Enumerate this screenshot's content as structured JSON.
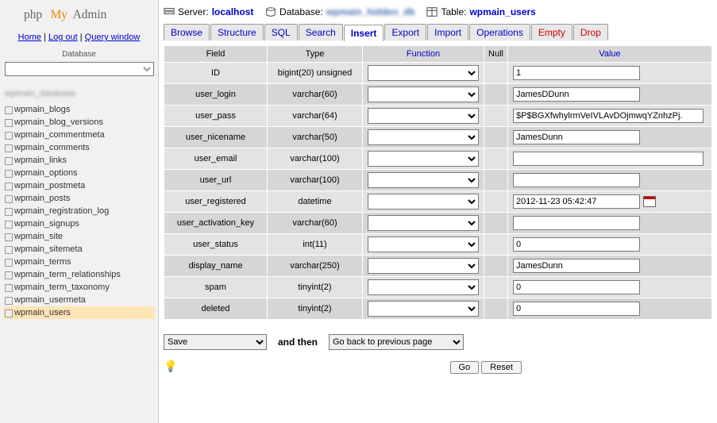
{
  "logo": {
    "php": "php",
    "my": "My",
    "admin": "Admin"
  },
  "toplinks": {
    "home": "Home",
    "logout": "Log out",
    "query": "Query window"
  },
  "db_label": "Database",
  "db_selected": "",
  "db_name": "wpmain_database",
  "tables": [
    "wpmain_blogs",
    "wpmain_blog_versions",
    "wpmain_commentmeta",
    "wpmain_comments",
    "wpmain_links",
    "wpmain_options",
    "wpmain_postmeta",
    "wpmain_posts",
    "wpmain_registration_log",
    "wpmain_signups",
    "wpmain_site",
    "wpmain_sitemeta",
    "wpmain_terms",
    "wpmain_term_relationships",
    "wpmain_term_taxonomy",
    "wpmain_usermeta",
    "wpmain_users"
  ],
  "active_table": "wpmain_users",
  "breadcrumb": {
    "server_lbl": "Server:",
    "server": "localhost",
    "db_lbl": "Database:",
    "db": "(hidden)",
    "table_lbl": "Table:",
    "table": "wpmain_users"
  },
  "tabs": {
    "browse": "Browse",
    "structure": "Structure",
    "sql": "SQL",
    "search": "Search",
    "insert": "Insert",
    "export": "Export",
    "import": "Import",
    "operations": "Operations",
    "empty": "Empty",
    "drop": "Drop"
  },
  "headers": {
    "field": "Field",
    "type": "Type",
    "function": "Function",
    "null": "Null",
    "value": "Value"
  },
  "rows": [
    {
      "field": "ID",
      "type": "bigint(20) unsigned",
      "value": "1"
    },
    {
      "field": "user_login",
      "type": "varchar(60)",
      "value": "JamesDDunn"
    },
    {
      "field": "user_pass",
      "type": "varchar(64)",
      "value": "$P$BGXfwhylrmVeIVLAvDOjmwqYZnhzPj."
    },
    {
      "field": "user_nicename",
      "type": "varchar(50)",
      "value": "JamesDunn"
    },
    {
      "field": "user_email",
      "type": "varchar(100)",
      "value": ""
    },
    {
      "field": "user_url",
      "type": "varchar(100)",
      "value": ""
    },
    {
      "field": "user_registered",
      "type": "datetime",
      "value": "2012-11-23 05:42:47",
      "cal": true
    },
    {
      "field": "user_activation_key",
      "type": "varchar(60)",
      "value": ""
    },
    {
      "field": "user_status",
      "type": "int(11)",
      "value": "0"
    },
    {
      "field": "display_name",
      "type": "varchar(250)",
      "value": "JamesDunn"
    },
    {
      "field": "spam",
      "type": "tinyint(2)",
      "value": "0"
    },
    {
      "field": "deleted",
      "type": "tinyint(2)",
      "value": "0"
    }
  ],
  "actions": {
    "save": "Save",
    "and_then": "and then",
    "goback": "Go back to previous page",
    "go": "Go",
    "reset": "Reset"
  }
}
